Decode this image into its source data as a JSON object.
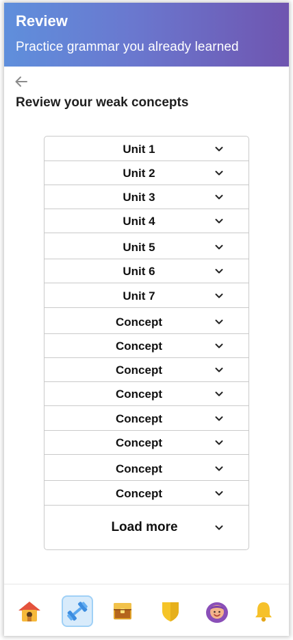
{
  "header": {
    "title": "Review",
    "subtitle": "Practice grammar you already learned"
  },
  "page": {
    "heading": "Review your weak concepts"
  },
  "list": {
    "items": [
      {
        "label": "Unit 1"
      },
      {
        "label": "Unit 2"
      },
      {
        "label": "Unit 3"
      },
      {
        "label": "Unit 4"
      },
      {
        "label": "Unit 5"
      },
      {
        "label": "Unit 6"
      },
      {
        "label": "Unit 7"
      },
      {
        "label": "Concept"
      },
      {
        "label": "Concept"
      },
      {
        "label": "Concept"
      },
      {
        "label": "Concept"
      },
      {
        "label": "Concept"
      },
      {
        "label": "Concept"
      },
      {
        "label": "Concept"
      },
      {
        "label": "Concept"
      }
    ],
    "load_more": "Load more"
  },
  "bottom_nav": {
    "items": [
      {
        "icon": "home-icon"
      },
      {
        "icon": "dumbbell-icon",
        "active": true
      },
      {
        "icon": "treasure-chest-icon"
      },
      {
        "icon": "shield-icon"
      },
      {
        "icon": "avatar-icon"
      },
      {
        "icon": "bell-icon"
      }
    ]
  },
  "colors": {
    "header_start": "#5f8fdc",
    "header_end": "#6f55b0",
    "active_tab_bg": "#d8ebfb"
  }
}
